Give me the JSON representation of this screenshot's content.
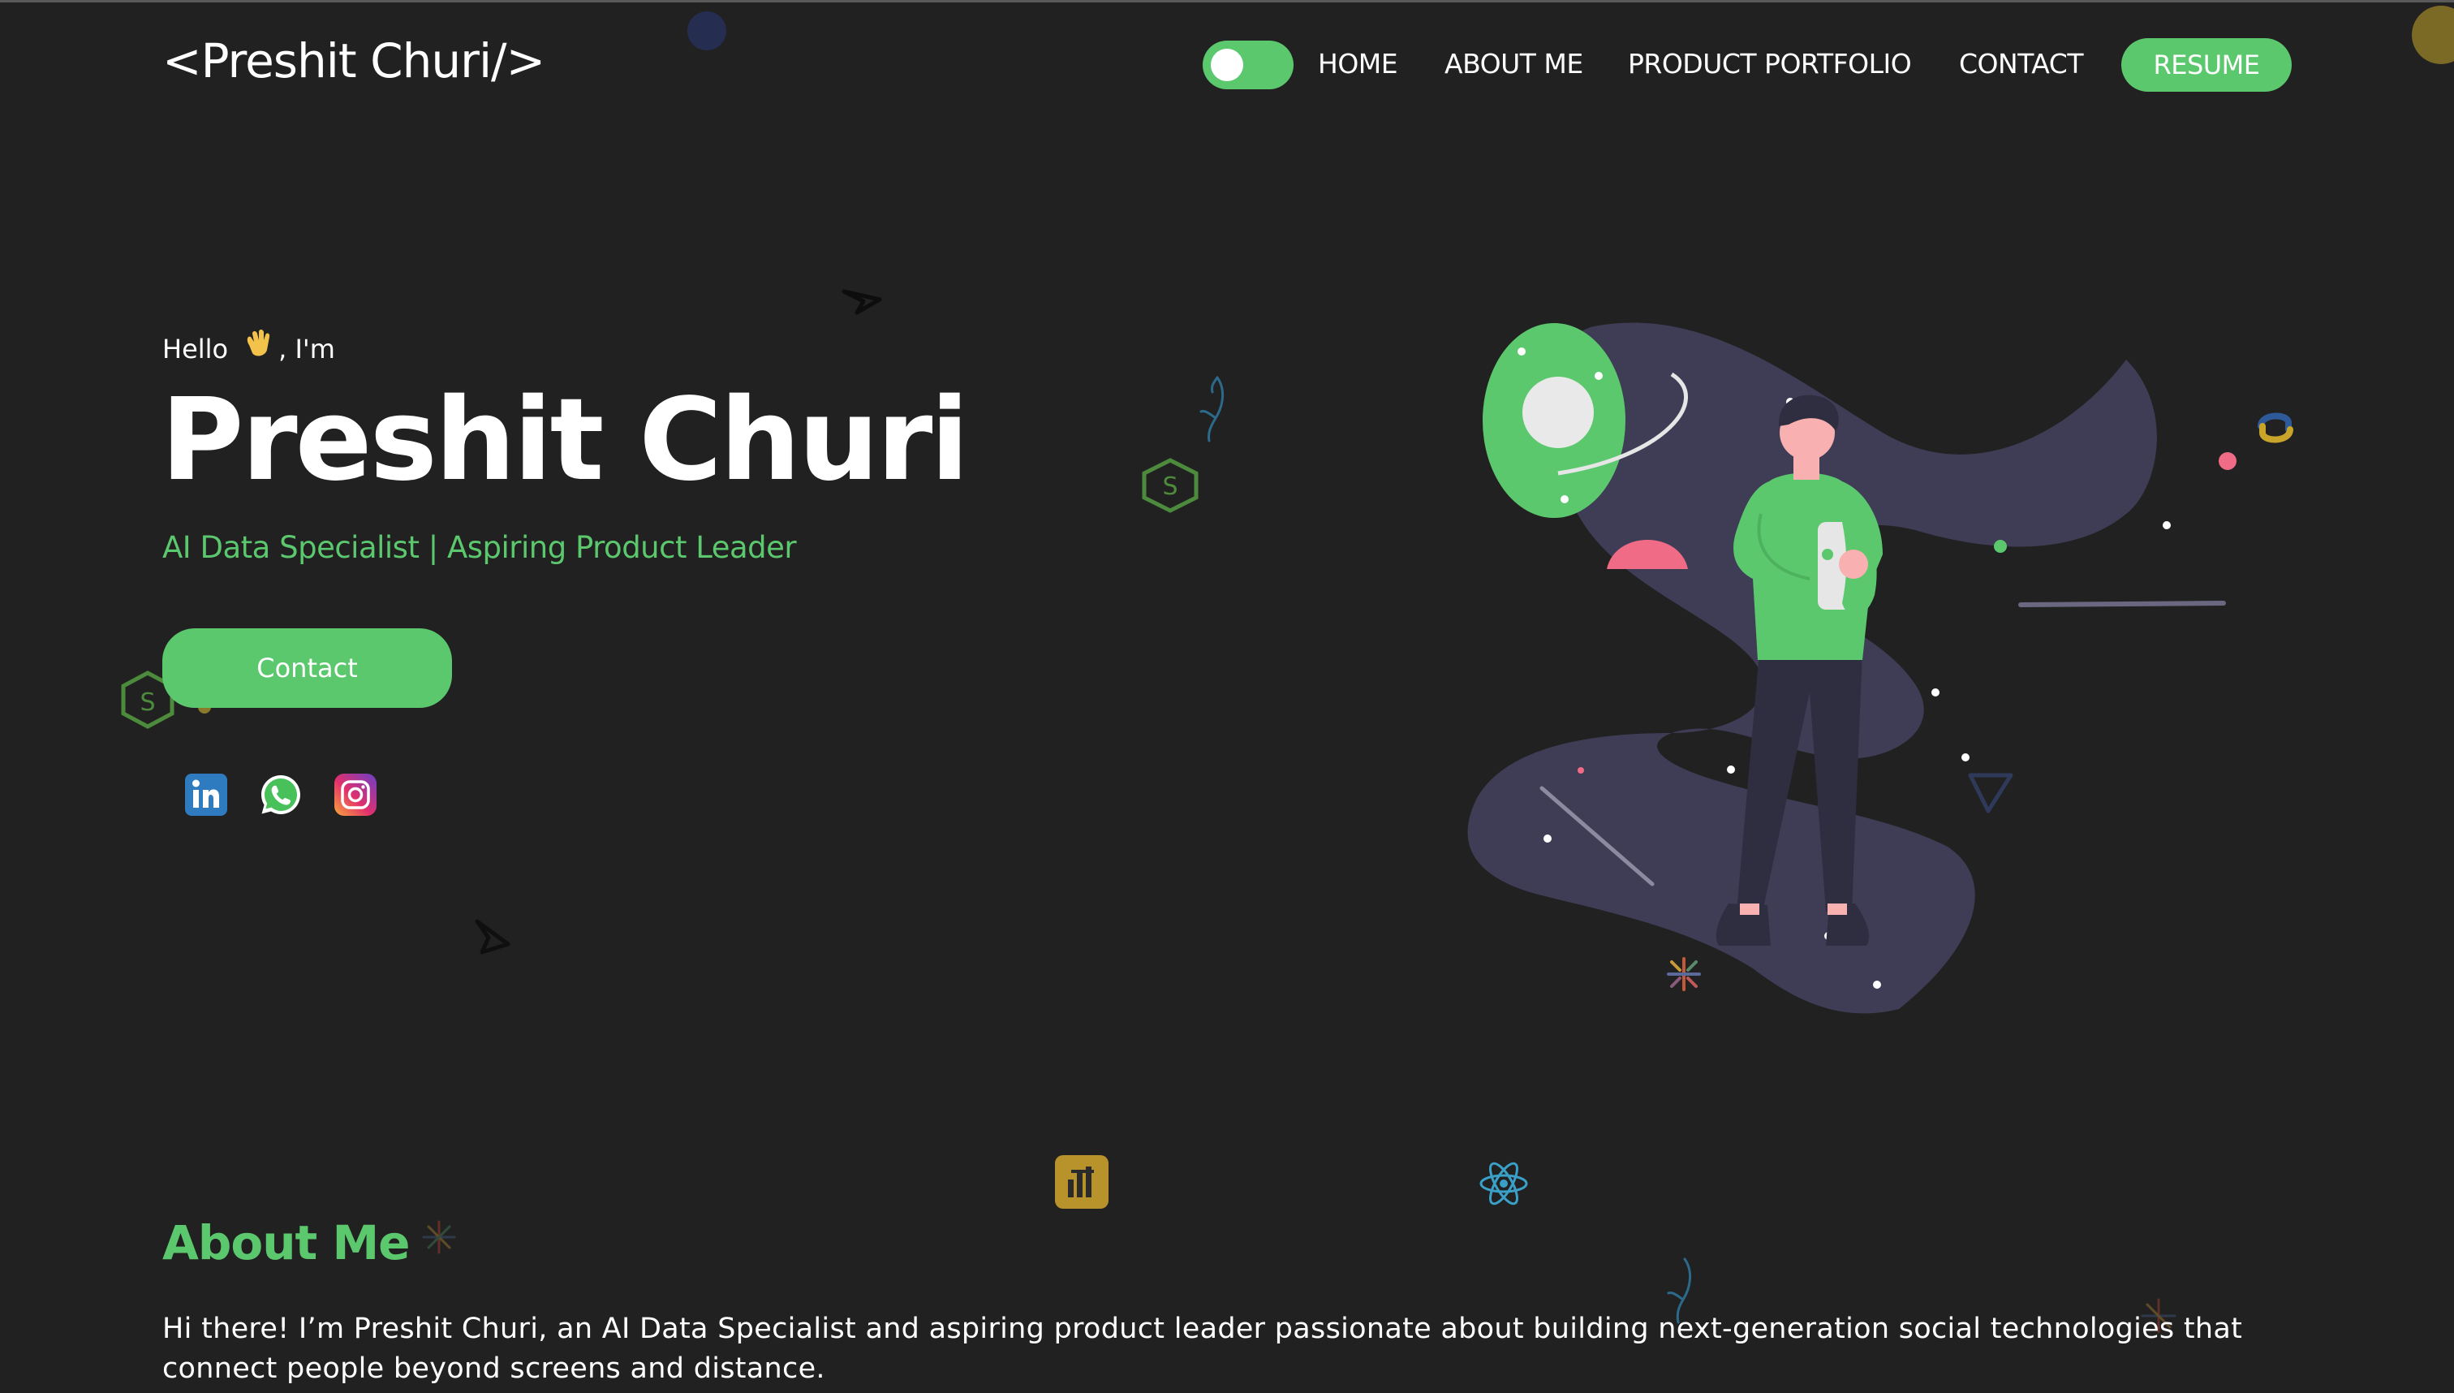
{
  "nav": {
    "logo": "<Preshit Churi/>",
    "links": [
      "HOME",
      "ABOUT ME",
      "PRODUCT PORTFOLIO",
      "CONTACT"
    ],
    "resume_label": "RESUME",
    "theme_toggle_on": true
  },
  "hero": {
    "hello_prefix": "Hello",
    "hello_suffix": ", I'm",
    "name": "Preshit Churi",
    "subtitle": "AI Data Specialist | Aspiring Product Leader",
    "contact_label": "Contact",
    "socials": [
      "linkedin-icon",
      "whatsapp-icon",
      "instagram-icon"
    ]
  },
  "about": {
    "title": "About Me",
    "text": "Hi there! I’m Preshit Churi, an AI Data Specialist and aspiring product leader passionate about building next-generation social technologies that connect people beyond screens and distance."
  },
  "colors": {
    "accent": "#5cc86e",
    "background": "#212121",
    "illustration_purple": "#3f3d56",
    "pink": "#f06b85"
  }
}
